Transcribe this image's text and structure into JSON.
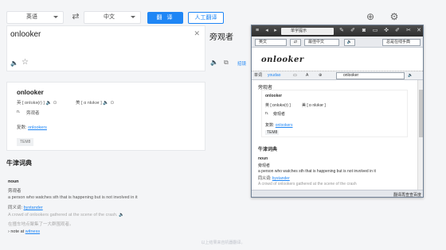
{
  "topbar": {
    "source_lang": "英语",
    "target_lang": "中文",
    "translate_label": "翻 译",
    "human_label": "人工翻译"
  },
  "input": {
    "value": "onlooker"
  },
  "result": {
    "translation": "旁观者",
    "side_link": "招镜"
  },
  "dict": {
    "word": "onlooker",
    "uk_label": "英",
    "uk_phonetic": "[ ɒnlʊkə(r) ]",
    "us_label": "美",
    "us_phonetic": "[ ɑ nlʊkər ]",
    "pos": "n.",
    "meaning": "旁观者",
    "related_label": "复数:",
    "related_value": "onlookers",
    "tag": "TEM8"
  },
  "oxford": {
    "title": "牛津词典",
    "pos": "noun",
    "meaning_cn": "旁观者",
    "definition": "a person who watches sth that is happening but is not involved in it",
    "synonym_label": "同义词:",
    "synonym_value": "bystander",
    "example_en": "A crowd of onlookers gathered at the scene of the crash.",
    "example_cn": "在撞车地点聚集了一大群围观者。",
    "note_prefix": "note at",
    "note_link": "witness"
  },
  "footer": {
    "text": "以上结果来自机器翻译。"
  },
  "popup": {
    "search_placeholder": "单字提示",
    "src_lang": "英文",
    "dst_lang": "最佳中文",
    "mode_label": "总是在线手典",
    "handwriting": "onlooker",
    "t3_a": "单词",
    "t3_b": "youdao",
    "query": "onlooker",
    "result_word": "旁观者",
    "sub_word": "onlooker",
    "sub_uk": "英 [ ɒnlʊkə(r) ]",
    "sub_us": "美 [ ɒ nlʊkər ]",
    "sub_pos": "n.",
    "sub_meaning": "旁观者",
    "sub_related_label": "复数:",
    "sub_related": "onlookers",
    "sub_tag": "TEM8",
    "oxf_title": "牛津词典",
    "oxf_pos": "noun",
    "oxf_cn": "旁观者",
    "oxf_def": "a person who watches sth that is happening but is not involved in it",
    "oxf_syn_label": "同义词:",
    "oxf_syn": "bystander",
    "oxf_example": "A crowd of onlookers gathered at the scene of the crash",
    "bottom_label": "翻译再查查百度"
  }
}
